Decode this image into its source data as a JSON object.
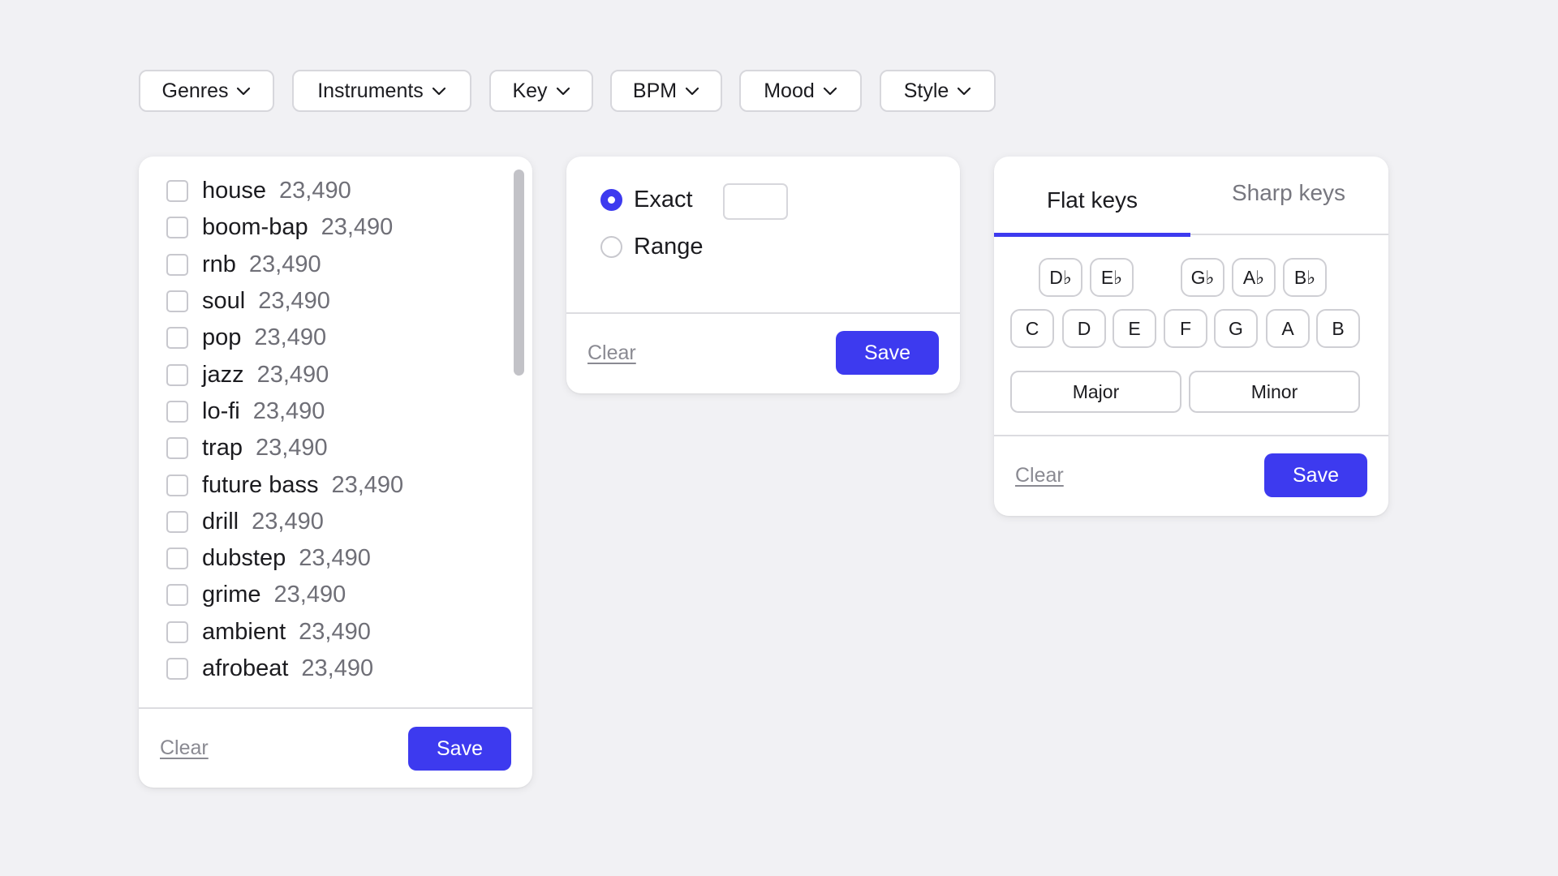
{
  "colors": {
    "accent": "#3d3aef",
    "background": "#f1f1f4",
    "card": "#ffffff",
    "muted_text": "#6f6f77"
  },
  "filters": [
    {
      "label": "Genres",
      "icon": "chevron-down-icon"
    },
    {
      "label": "Instruments",
      "icon": "chevron-down-icon"
    },
    {
      "label": "Key",
      "icon": "chevron-down-icon"
    },
    {
      "label": "BPM",
      "icon": "chevron-down-icon"
    },
    {
      "label": "Mood",
      "icon": "chevron-down-icon"
    },
    {
      "label": "Style",
      "icon": "chevron-down-icon"
    }
  ],
  "genres_panel": {
    "items": [
      {
        "name": "house",
        "count": "23,490",
        "checked": false
      },
      {
        "name": "boom-bap",
        "count": "23,490",
        "checked": false
      },
      {
        "name": "rnb",
        "count": "23,490",
        "checked": false
      },
      {
        "name": "soul",
        "count": "23,490",
        "checked": false
      },
      {
        "name": "pop",
        "count": "23,490",
        "checked": false
      },
      {
        "name": "jazz",
        "count": "23,490",
        "checked": false
      },
      {
        "name": "lo-fi",
        "count": "23,490",
        "checked": false
      },
      {
        "name": "trap",
        "count": "23,490",
        "checked": false
      },
      {
        "name": "future bass",
        "count": "23,490",
        "checked": false
      },
      {
        "name": "drill",
        "count": "23,490",
        "checked": false
      },
      {
        "name": "dubstep",
        "count": "23,490",
        "checked": false
      },
      {
        "name": "grime",
        "count": "23,490",
        "checked": false
      },
      {
        "name": "ambient",
        "count": "23,490",
        "checked": false
      },
      {
        "name": "afrobeat",
        "count": "23,490",
        "checked": false
      }
    ],
    "clear_label": "Clear",
    "save_label": "Save"
  },
  "bpm_panel": {
    "exact_label": "Exact",
    "range_label": "Range",
    "selected": "exact",
    "exact_value": "",
    "clear_label": "Clear",
    "save_label": "Save"
  },
  "key_panel": {
    "tabs": [
      {
        "label": "Flat keys",
        "active": true
      },
      {
        "label": "Sharp keys",
        "active": false
      }
    ],
    "flat_keys": [
      "D♭",
      "E♭",
      "G♭",
      "A♭",
      "B♭"
    ],
    "natural_keys": [
      "C",
      "D",
      "E",
      "F",
      "G",
      "A",
      "B"
    ],
    "modes": [
      "Major",
      "Minor"
    ],
    "clear_label": "Clear",
    "save_label": "Save"
  }
}
